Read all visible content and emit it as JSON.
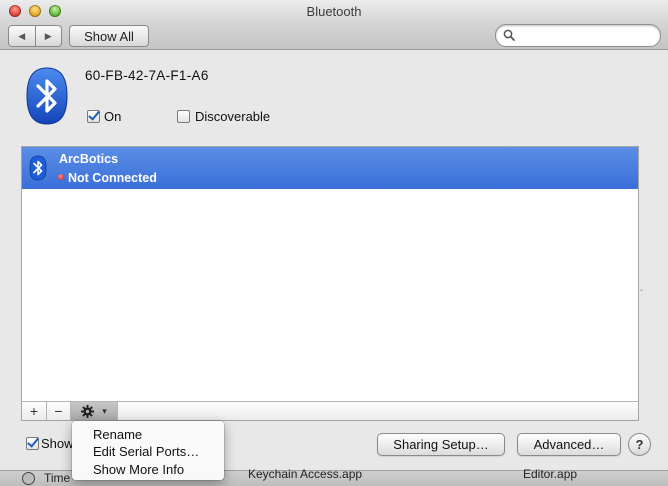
{
  "window": {
    "title": "Bluetooth"
  },
  "toolbar": {
    "back_icon": "triangle-left-icon",
    "forward_icon": "triangle-right-icon",
    "show_all_label": "Show All",
    "search_value": "",
    "search_placeholder": ""
  },
  "device_info": {
    "address": "60-FB-42-7A-F1-A6",
    "on_label": "On",
    "on_checked": true,
    "discoverable_label": "Discoverable",
    "discoverable_checked": false
  },
  "device_list": {
    "items": [
      {
        "name": "ArcBotics",
        "status": "Not Connected",
        "selected": true
      }
    ]
  },
  "list_controls": {
    "add": "+",
    "remove": "−",
    "gear_icon": "gear-icon",
    "arrow": "▾"
  },
  "show_option": {
    "label": "Show",
    "checked": true
  },
  "context_menu": {
    "items": [
      "Rename",
      "Edit Serial Ports…",
      "Show More Info"
    ]
  },
  "buttons": {
    "sharing_setup": "Sharing Setup…",
    "advanced": "Advanced…",
    "help": "?"
  },
  "background_strip": {
    "left_text": "Time",
    "middle_text": "Keychain Access.app",
    "right_text": "Editor.app"
  },
  "colors": {
    "selection": "#3a6fd8",
    "bluetooth_blue": "#1f5fd6"
  }
}
